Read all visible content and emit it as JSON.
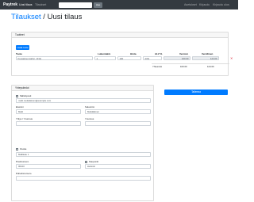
{
  "navbar": {
    "brand": "Paytrek",
    "links": [
      "Uusi tilaus",
      "Tilaukset"
    ],
    "search_placeholder": "",
    "search_button": "Hae",
    "right_links": [
      "Asetukset",
      "Kirjaudu",
      "Kirjaudu ulos"
    ]
  },
  "title": {
    "link": "Tilaukset",
    "separator": " / ",
    "current": "Uusi tilaus"
  },
  "order": {
    "header": "Tuotteet",
    "add_button": "Lisää tuote",
    "columns": [
      "Tuote",
      "Lukumäärä",
      "Hinta",
      "ALV %",
      "Veroton",
      "Verollinen"
    ],
    "row": {
      "product": "Kuusaimen kahvi, 10 kk",
      "quantity": "1",
      "price": "100",
      "vat": "24%",
      "net": "100.00",
      "gross": "124.00"
    },
    "totals_label": "Yhteensä",
    "total_net": "100.00",
    "total_gross": "124.00"
  },
  "customer": {
    "header": "Yhteystiedot",
    "email_label": "Sähköposti",
    "email_value": "matti.meikalainen@example.com",
    "firstname_label": "Etunimi",
    "firstname_value": "Matti",
    "lastname_label": "Sukunimi",
    "lastname_value": "Meikäläinen",
    "company_label": "Yritys / Y-tunnus",
    "company_value": "",
    "phone_label": "Y-tunnus",
    "phone_value": "",
    "address_label": "Osoite",
    "address_value": "Mallikatu 1",
    "postal_label": "Postinumero",
    "postal_value": "00100",
    "city_label": "Kaupunki",
    "city_value": "Helsinki",
    "phone2_label": "Puhelinnumero",
    "phone2_value": ""
  },
  "save_button": "Tallenna"
}
